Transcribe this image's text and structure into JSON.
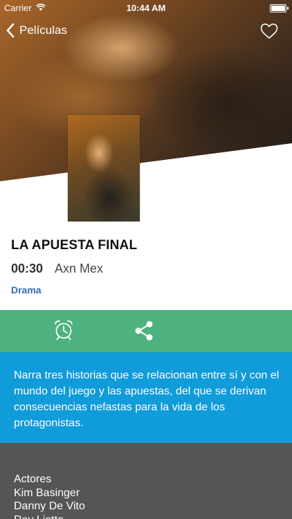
{
  "status_bar": {
    "carrier": "Carrier",
    "time": "10:44 AM"
  },
  "nav": {
    "back_label": "Películas"
  },
  "movie": {
    "title": "LA APUESTA FINAL",
    "time": "00:30",
    "channel": "Axn Mex",
    "genre": "Drama",
    "description": "Narra tres historias que se relacionan entre sí y con el mundo del juego y las apuestas, del que se derivan consecuencias nefastas para la vida de los protagonistas."
  },
  "cast": {
    "heading": "Actores",
    "actors": [
      "Kim Basinger",
      "Danny De Vito",
      "Ray Liotta"
    ]
  },
  "colors": {
    "action_bar": "#4db27e",
    "description_bg": "#109bd9",
    "cast_bg": "#555555",
    "genre_link": "#2f6db0"
  },
  "icons": {
    "back": "chevron-left-icon",
    "favorite": "heart-icon",
    "alarm": "alarm-clock-icon",
    "share": "share-icon"
  }
}
